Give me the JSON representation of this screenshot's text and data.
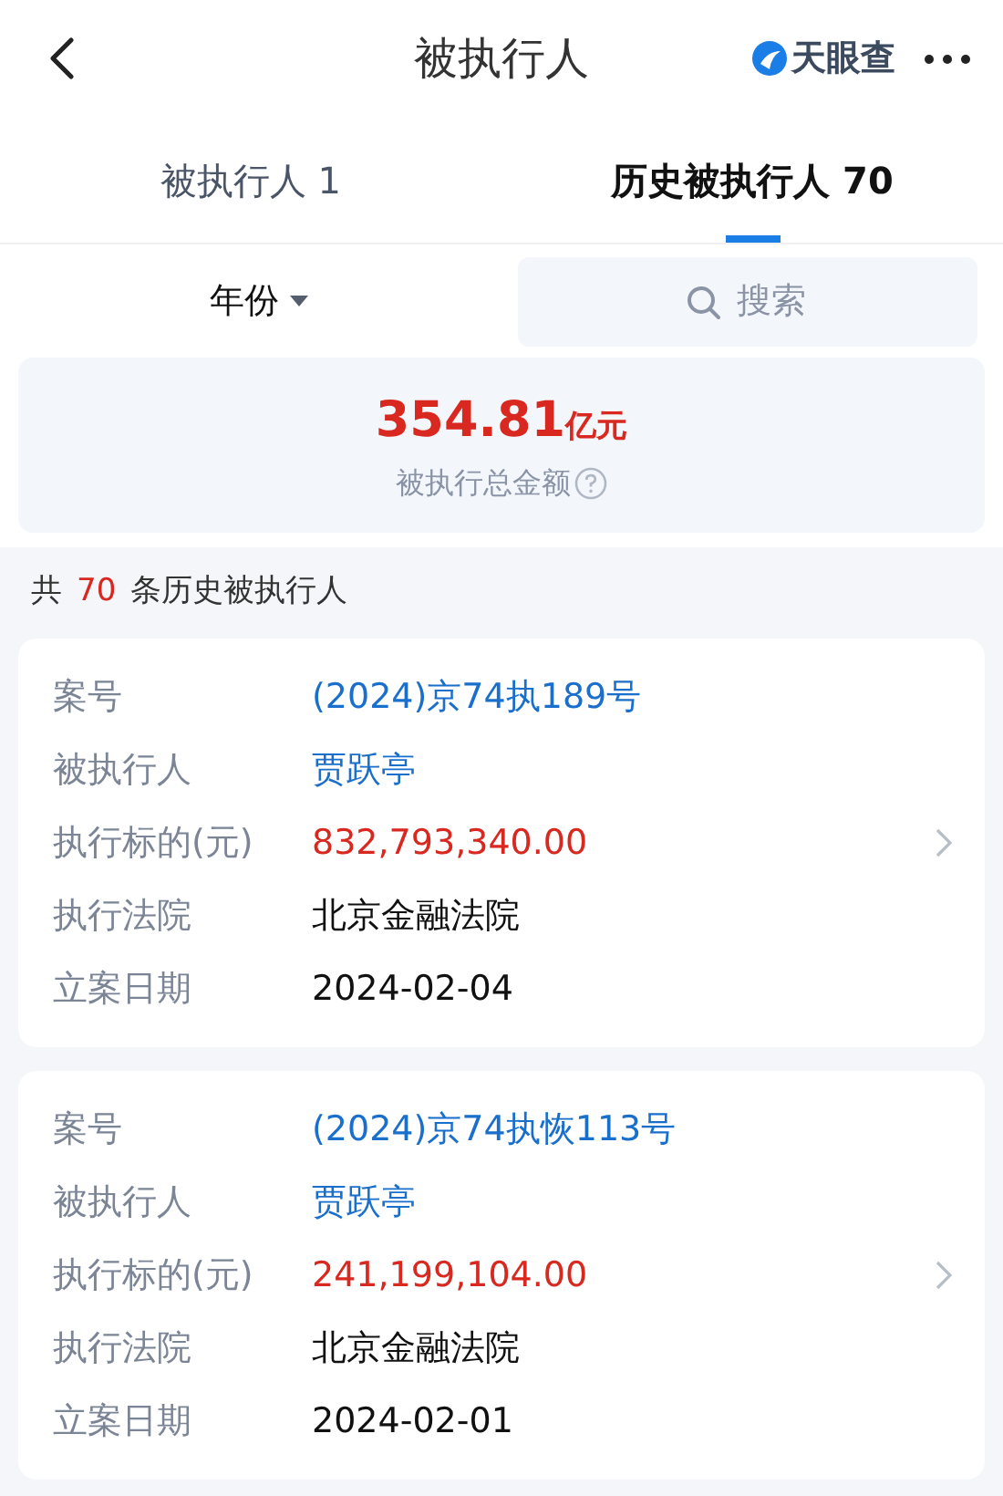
{
  "header": {
    "title": "被执行人",
    "brand": "天眼查"
  },
  "tabs": [
    {
      "label": "被执行人 1",
      "selected": false
    },
    {
      "label": "历史被执行人 70",
      "selected": true
    }
  ],
  "filter": {
    "label": "年份"
  },
  "search": {
    "placeholder": "搜索"
  },
  "summary": {
    "amount": "354.81",
    "unit": "亿元",
    "label": "被执行总金额"
  },
  "count": {
    "prefix": "共",
    "value": "70",
    "suffix": "条历史被执行人"
  },
  "cases": [
    {
      "fields": [
        {
          "label": "案号",
          "value": "(2024)京74执189号",
          "kind": "link"
        },
        {
          "label": "被执行人",
          "value": "贾跃亭",
          "kind": "link"
        },
        {
          "label": "执行标的(元)",
          "value": "832,793,340.00",
          "kind": "amount"
        },
        {
          "label": "执行法院",
          "value": "北京金融法院",
          "kind": "plain"
        },
        {
          "label": "立案日期",
          "value": "2024-02-04",
          "kind": "plain"
        }
      ]
    },
    {
      "fields": [
        {
          "label": "案号",
          "value": "(2024)京74执恢113号",
          "kind": "link"
        },
        {
          "label": "被执行人",
          "value": "贾跃亭",
          "kind": "link"
        },
        {
          "label": "执行标的(元)",
          "value": "241,199,104.00",
          "kind": "amount"
        },
        {
          "label": "执行法院",
          "value": "北京金融法院",
          "kind": "plain"
        },
        {
          "label": "立案日期",
          "value": "2024-02-01",
          "kind": "plain"
        }
      ]
    }
  ]
}
